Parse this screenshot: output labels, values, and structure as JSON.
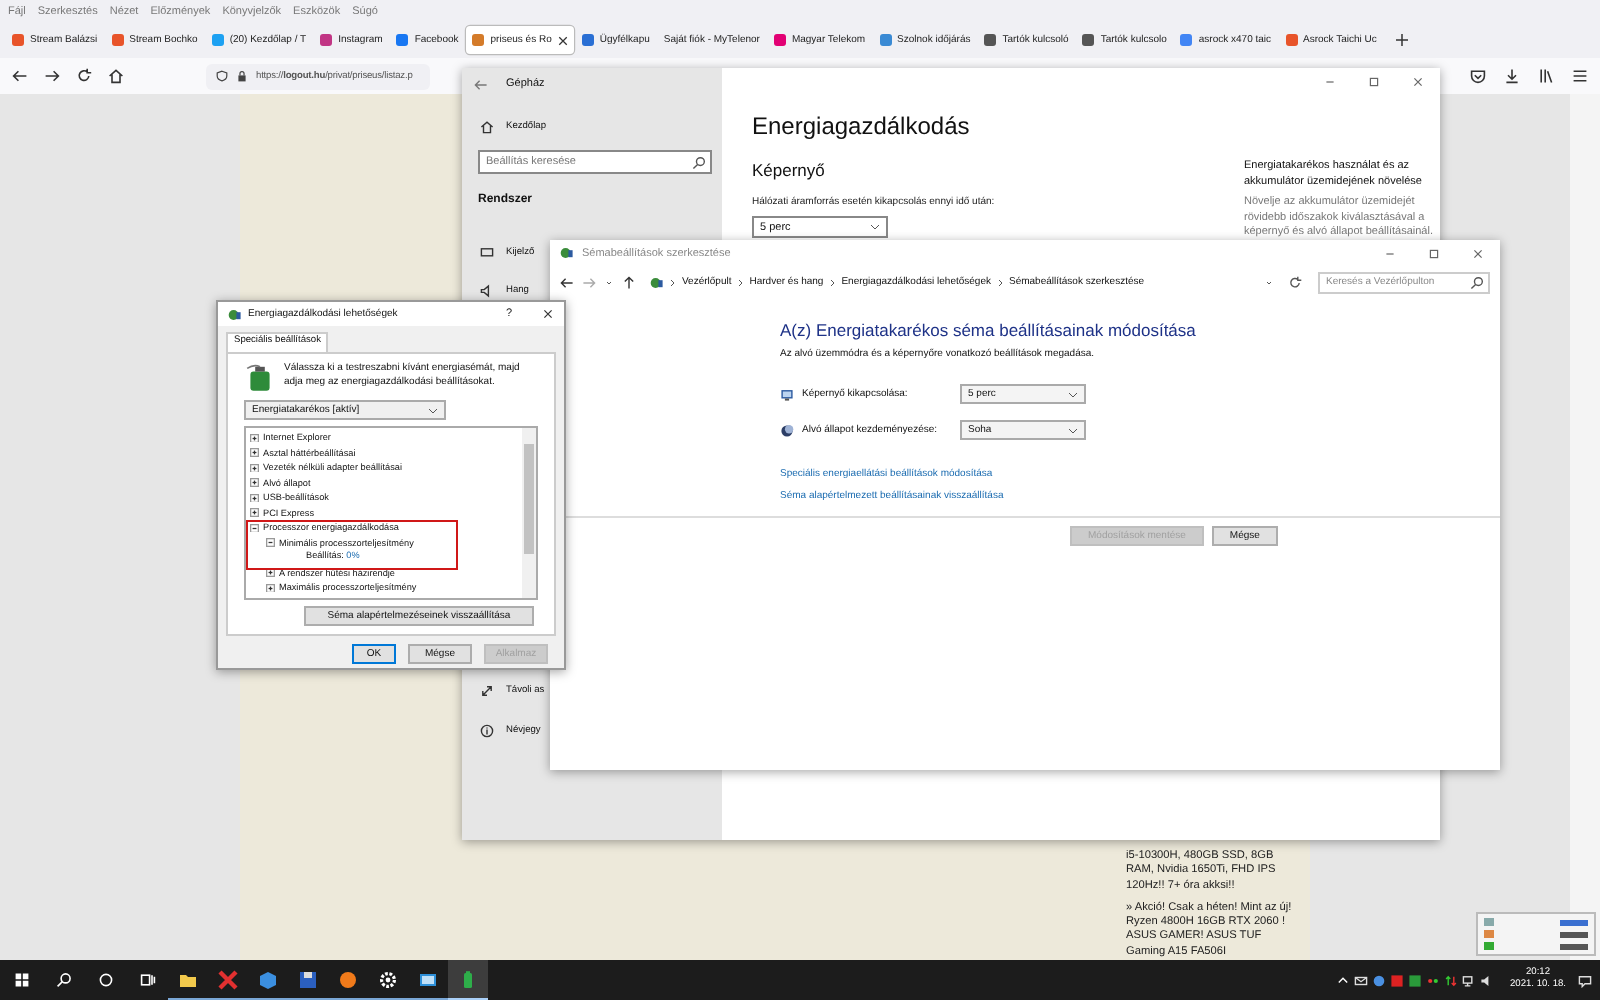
{
  "browser": {
    "menu": [
      "Fájl",
      "Szerkesztés",
      "Nézet",
      "Előzmények",
      "Könyvjelzők",
      "Eszközök",
      "Súgó"
    ],
    "tabs": [
      {
        "label": "Stream Balázsi",
        "kind": "stream",
        "selected": false
      },
      {
        "label": "Stream Bochko",
        "kind": "stream",
        "selected": false
      },
      {
        "label": "(20) Kezdőlap / T",
        "kind": "bird",
        "selected": false
      },
      {
        "label": "Instagram",
        "kind": "insta",
        "selected": false
      },
      {
        "label": "Facebook",
        "kind": "fb",
        "selected": false
      },
      {
        "label": "priseus és Ro",
        "kind": "ring",
        "selected": true
      },
      {
        "label": "Ügyfélkapu",
        "kind": "card",
        "selected": false
      },
      {
        "label": "Saját fiók - MyTelenor",
        "kind": "plain",
        "selected": false
      },
      {
        "label": "Magyar Telekom",
        "kind": "t",
        "selected": false
      },
      {
        "label": "Szolnok időjárás",
        "kind": "weather",
        "selected": false
      },
      {
        "label": "Tartók kulcsoló",
        "kind": "pin",
        "selected": false
      },
      {
        "label": "Tartók kulcsolo",
        "kind": "pin",
        "selected": false
      },
      {
        "label": "asrock x470 taic",
        "kind": "google",
        "selected": false
      },
      {
        "label": "Asrock Taichi Uc",
        "kind": "stream",
        "selected": false
      }
    ],
    "url": "https://**logout.hu**/privat/priseus/listaz.p",
    "ads": [
      "i5-10300H, 480GB SSD, 8GB RAM, Nvidia 1650Ti, FHD IPS 120Hz!! 7+ óra akksi!!",
      "» Akció! Csak a héten! Mint az új! Ryzen 4800H 16GB RTX 2060 ! ASUS GAMER! ASUS TUF Gaming A15 FA506I"
    ]
  },
  "settings": {
    "title": "Gépház",
    "home": "Kezdőlap",
    "search": {
      "placeholder": "Beállítás keresése"
    },
    "section": "Rendszer",
    "nav_top": [
      {
        "label": "Kijelző",
        "kind": "display"
      },
      {
        "label": "Hang",
        "kind": "sound"
      }
    ],
    "nav_bottom": [
      {
        "label": "Távoli as",
        "kind": "remote"
      },
      {
        "label": "Névjegy",
        "kind": "info"
      }
    ],
    "heading": "Energiagazdálkodás",
    "subheading": "Képernyő",
    "field_label": "Hálózati áramforrás esetén kikapcsolás ennyi idő után:",
    "field_value": "5 perc",
    "side_title": "Energiatakarékos használat és az akkumulátor üzemidejének növelése",
    "side_text": "Növelje az akkumulátor üzemidejét rövidebb időszakok kiválasztásával a képernyő és alvó állapot beállításainál."
  },
  "control_panel": {
    "title": "Sémabeállítások szerkesztése",
    "breadcrumb": [
      "Vezérlőpult",
      "Hardver és hang",
      "Energiagazdálkodási lehetőségek",
      "Sémabeállítások szerkesztése"
    ],
    "search": {
      "placeholder": "Keresés a Vezérlőpulton"
    },
    "heading": "A(z) Energiatakarékos séma beállításainak módosítása",
    "subtitle": "Az alvó üzemmódra és a képernyőre vonatkozó beállítások megadása.",
    "rows": [
      {
        "kind": "display",
        "label": "Képernyő kikapcsolása:",
        "value": "5 perc"
      },
      {
        "kind": "sleep",
        "label": "Alvó állapot kezdeményezése:",
        "value": "Soha"
      }
    ],
    "links": [
      "Speciális energiaellátási beállítások módosítása",
      "Séma alapértelmezett beállításainak visszaállítása"
    ],
    "buttons": [
      {
        "label": "Módosítások mentése",
        "disabled": true
      },
      {
        "label": "Mégse",
        "disabled": false
      }
    ]
  },
  "dialog": {
    "title": "Energiagazdálkodási lehetőségek",
    "help": "?",
    "tab": "Speciális beállítások",
    "description": "Válassza ki a testreszabni kívánt energiasémát, majd adja meg az energiagazdálkodási beállításokat.",
    "plan": "Energiatakarékos [aktív]",
    "tree": [
      {
        "label": "Internet Explorer",
        "expanded": false
      },
      {
        "label": "Asztal háttérbeállításai",
        "expanded": false
      },
      {
        "label": "Vezeték nélküli adapter beállításai",
        "expanded": false
      },
      {
        "label": "Alvó állapot",
        "expanded": false
      },
      {
        "label": "USB-beállítások",
        "expanded": false
      },
      {
        "label": "PCI Express",
        "expanded": false
      },
      {
        "label": "Processzor energiagazdálkodása",
        "expanded": true,
        "highlighted": true,
        "children": [
          {
            "label": "Minimális processzorteljesítmény",
            "expanded": true,
            "highlighted": true,
            "children": [
              {
                "label": "Beállítás:",
                "value": "0%",
                "highlighted": true
              }
            ]
          },
          {
            "label": "A rendszer hűtési házirendje",
            "expanded": false
          },
          {
            "label": "Maximális processzorteljesítmény",
            "expanded": false
          }
        ]
      }
    ],
    "reset": "Séma alapértelmezéseinek visszaállítása",
    "buttons": [
      {
        "label": "OK",
        "disabled": false
      },
      {
        "label": "Mégse",
        "disabled": false
      },
      {
        "label": "Alkalmaz",
        "disabled": true
      }
    ]
  },
  "taskbar": {
    "apps": [
      {
        "kind": "folder",
        "selected": false
      },
      {
        "kind": "x",
        "selected": false
      },
      {
        "kind": "cube",
        "selected": false
      },
      {
        "kind": "floppy",
        "selected": false
      },
      {
        "kind": "fox",
        "selected": false
      },
      {
        "kind": "gear",
        "selected": false
      },
      {
        "kind": "window",
        "selected": false
      },
      {
        "kind": "battery",
        "selected": true
      }
    ],
    "time": "20:12",
    "date": "2021. 10. 18."
  }
}
